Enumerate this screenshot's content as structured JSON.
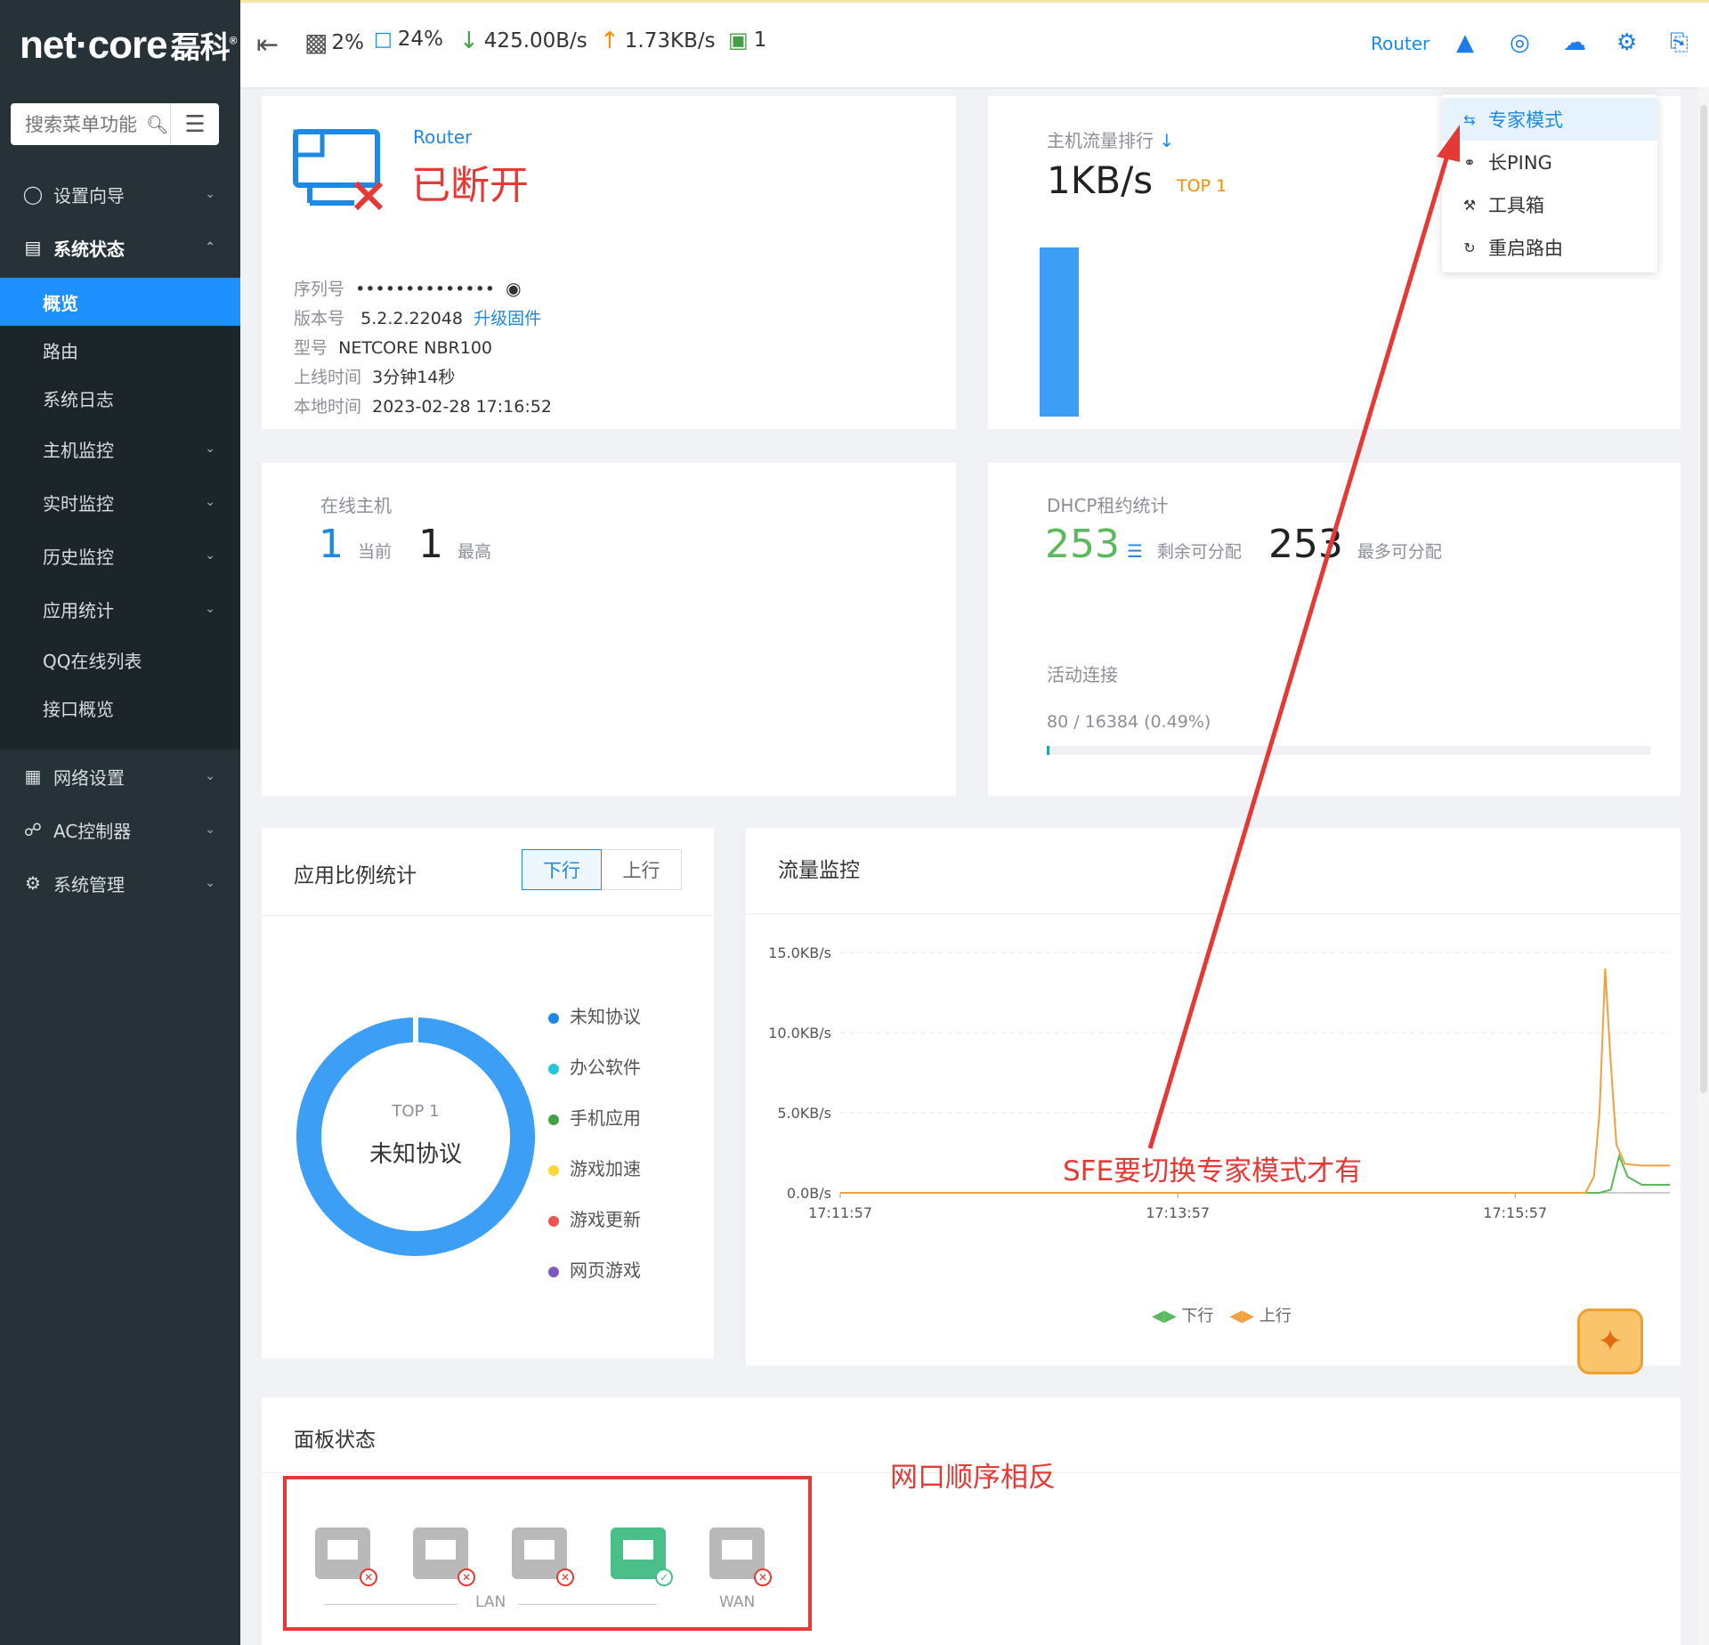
{
  "header": {
    "cpu": "2%",
    "mem": "24%",
    "down": "425.00B/s",
    "up": "1.73KB/s",
    "hosts": "1",
    "router_link": "Router"
  },
  "sidebar": {
    "logo_text": "net·core",
    "logo_cn": "磊科",
    "logo_mark": "®",
    "search_placeholder": "搜索菜单功能",
    "top_items": [
      {
        "label": "设置向导"
      },
      {
        "label": "系统状态"
      }
    ],
    "sub_items": [
      {
        "label": "概览"
      },
      {
        "label": "路由"
      },
      {
        "label": "系统日志"
      },
      {
        "label": "主机监控"
      },
      {
        "label": "实时监控"
      },
      {
        "label": "历史监控"
      },
      {
        "label": "应用统计"
      },
      {
        "label": "QQ在线列表"
      },
      {
        "label": "接口概览"
      }
    ],
    "bottom_items": [
      {
        "label": "网络设置"
      },
      {
        "label": "AC控制器"
      },
      {
        "label": "系统管理"
      }
    ]
  },
  "dropdown": {
    "items": [
      {
        "label": "专家模式"
      },
      {
        "label": "长PING"
      },
      {
        "label": "工具箱"
      },
      {
        "label": "重启路由"
      }
    ]
  },
  "router_card": {
    "name": "Router",
    "status": "已断开",
    "serial_label": "序列号",
    "serial_value": "••••••••••••••",
    "version_label": "版本号",
    "version_value": "5.2.2.22048",
    "upgrade_link": "升级固件",
    "model_label": "型号",
    "model_value": "NETCORE NBR100",
    "uptime_label": "上线时间",
    "uptime_value": "3分钟14秒",
    "localtime_label": "本地时间",
    "localtime_value": "2023-02-28 17:16:52"
  },
  "traffic_rank": {
    "title": "主机流量排行",
    "value": "1KB/s",
    "tag": "TOP 1",
    "bar_fraction": 1.0
  },
  "online_hosts": {
    "title": "在线主机",
    "current": "1",
    "current_label": "当前",
    "max": "1",
    "max_label": "最高"
  },
  "dhcp": {
    "title": "DHCP租约统计",
    "remaining": "253",
    "remaining_label": "剩余可分配",
    "max": "253",
    "max_label": "最多可分配",
    "conn_title": "活动连接",
    "conn_value": "80 / 16384 (0.49%)",
    "conn_fraction": 0.0049
  },
  "app_ratio": {
    "title": "应用比例统计",
    "tab_down": "下行",
    "tab_up": "上行",
    "center_top": "TOP 1",
    "center_label": "未知协议",
    "legend": [
      {
        "label": "未知协议",
        "color": "#1e88e5"
      },
      {
        "label": "办公软件",
        "color": "#26c6da"
      },
      {
        "label": "手机应用",
        "color": "#43a047"
      },
      {
        "label": "游戏加速",
        "color": "#fdd835"
      },
      {
        "label": "游戏更新",
        "color": "#ef5350"
      },
      {
        "label": "网页游戏",
        "color": "#7e57c2"
      }
    ]
  },
  "traffic_monitor": {
    "title": "流量监控",
    "legend_down": "下行",
    "legend_up": "上行"
  },
  "chart_data": {
    "type": "line",
    "title": "流量监控",
    "y_ticks": [
      "15.0KB/s",
      "10.0KB/s",
      "5.0KB/s",
      "0.0B/s"
    ],
    "x_ticks": [
      "17:11:57",
      "17:13:57",
      "17:15:57"
    ],
    "ylim": [
      0,
      15
    ],
    "xlim": [
      0,
      295
    ],
    "series": [
      {
        "name": "下行",
        "color": "#5cb85c",
        "points": [
          [
            0,
            0
          ],
          [
            270,
            0
          ],
          [
            274,
            0.2
          ],
          [
            277,
            2.3
          ],
          [
            280,
            1.0
          ],
          [
            285,
            0.5
          ],
          [
            295,
            0.5
          ]
        ]
      },
      {
        "name": "上行",
        "color": "#f0a040",
        "points": [
          [
            0,
            0
          ],
          [
            265,
            0
          ],
          [
            268,
            1.0
          ],
          [
            270,
            5.0
          ],
          [
            272,
            14.0
          ],
          [
            274,
            8.0
          ],
          [
            276,
            3.0
          ],
          [
            279,
            1.8
          ],
          [
            285,
            1.7
          ],
          [
            295,
            1.7
          ]
        ]
      }
    ]
  },
  "panel": {
    "title": "面板状态",
    "lan_label": "LAN",
    "wan_label": "WAN",
    "ports": [
      {
        "state": "down"
      },
      {
        "state": "down"
      },
      {
        "state": "down"
      },
      {
        "state": "up"
      },
      {
        "state": "down"
      }
    ]
  },
  "annotations": {
    "sfe_note": "SFE要切换专家模式才有",
    "port_note": "网口顺序相反"
  }
}
